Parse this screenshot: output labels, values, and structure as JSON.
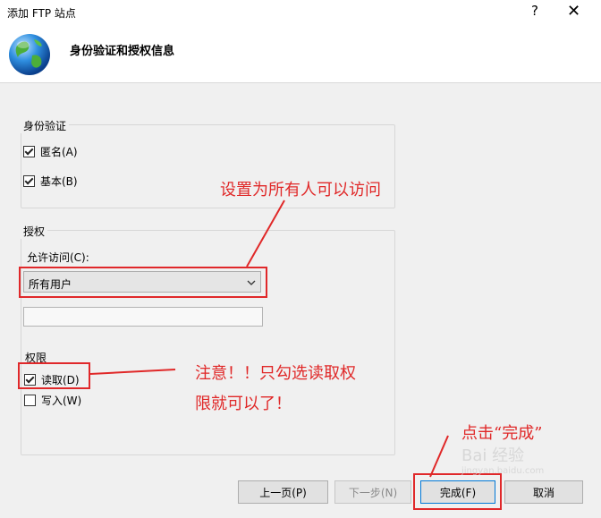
{
  "window": {
    "title": "添加 FTP 站点",
    "help": "?",
    "close": "✕"
  },
  "header": {
    "title": "身份验证和授权信息"
  },
  "auth": {
    "group_label": "身份验证",
    "anonymous": {
      "label": "匿名(A)",
      "checked": true
    },
    "basic": {
      "label": "基本(B)",
      "checked": true
    }
  },
  "authorization": {
    "group_label": "授权",
    "allow_label": "允许访问(C):",
    "allow_value": "所有用户",
    "text_value": "",
    "permissions_label": "权限",
    "read": {
      "label": "读取(D)",
      "checked": true
    },
    "write": {
      "label": "写入(W)",
      "checked": false
    }
  },
  "buttons": {
    "prev": "上一页(P)",
    "next": "下一步(N)",
    "finish": "完成(F)",
    "cancel": "取消"
  },
  "annotations": {
    "note1": "设置为所有人可以访问",
    "note2_line1": "注意！！只勾选读取权",
    "note2_line2": "限就可以了！",
    "note3": "点击“完成”"
  },
  "watermark": {
    "text": "Bai 经验",
    "sub": "jingyan.baidu.com"
  },
  "colors": {
    "annotation": "#e02828",
    "primary_border": "#0078d7"
  }
}
